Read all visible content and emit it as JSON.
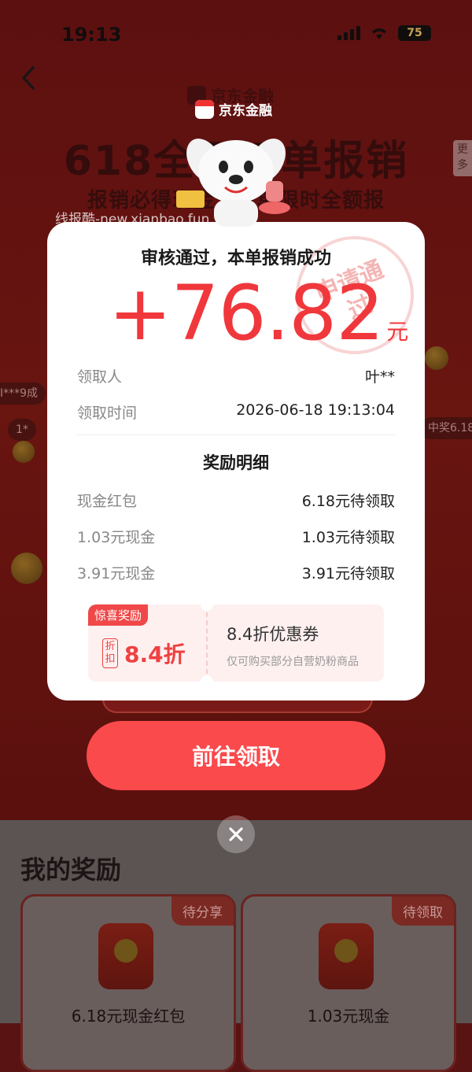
{
  "status_bar": {
    "time": "19:13",
    "battery": "75"
  },
  "background": {
    "brand": "京东金融",
    "hero_title": "618全网订单报销",
    "hero_subtitle": "报销必得现金，订单限时全额报",
    "more_tab": "更多",
    "tickers": [
      "I***9成",
      "1*",
      "中奖6.18"
    ]
  },
  "watermark": "线报酷-new.xianbao.fun",
  "modal": {
    "brand": "京东金融",
    "stamp": "申请通过",
    "title": "审核通过，本单报销成功",
    "amount": "+76.82",
    "amount_unit": "元",
    "info_rows": [
      {
        "label": "领取人",
        "value": "叶**"
      },
      {
        "label": "领取时间",
        "value": "2026-06-18 19:13:04"
      }
    ],
    "detail_title": "奖励明细",
    "detail_rows": [
      {
        "label": "现金红包",
        "value": "6.18元待领取"
      },
      {
        "label": "1.03元现金",
        "value": "1.03元待领取"
      },
      {
        "label": "3.91元现金",
        "value": "3.91元待领取"
      }
    ],
    "coupon": {
      "tag": "惊喜奖励",
      "zhe_label": "折扣",
      "discount": "8.4折",
      "name": "8.4折优惠券",
      "desc": "仅可购买部分自营奶粉商品"
    }
  },
  "claim_button": "前往领取",
  "rewards": {
    "title": "我的奖励",
    "cards": [
      {
        "status": "待分享",
        "name": "6.18元现金红包"
      },
      {
        "status": "待领取",
        "name": "1.03元现金"
      }
    ]
  }
}
